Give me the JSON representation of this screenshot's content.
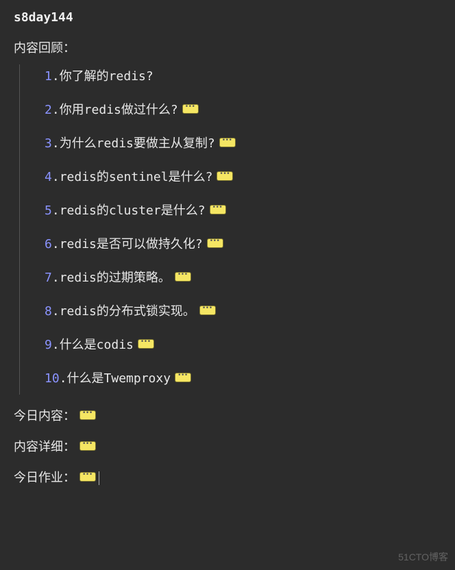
{
  "title": "s8day144",
  "review_label": "内容回顾：",
  "items": [
    {
      "n": "1",
      "text": "你了解的redis?",
      "badge": false
    },
    {
      "n": "2",
      "text": "你用redis做过什么?",
      "badge": true
    },
    {
      "n": "3",
      "text": "为什么redis要做主从复制?",
      "badge": true
    },
    {
      "n": "4",
      "text": "redis的sentinel是什么?",
      "badge": true
    },
    {
      "n": "5",
      "text": "redis的cluster是什么?",
      "badge": true
    },
    {
      "n": "6",
      "text": "redis是否可以做持久化?",
      "badge": true
    },
    {
      "n": "7",
      "text": "redis的过期策略。",
      "badge": true
    },
    {
      "n": "8",
      "text": "redis的分布式锁实现。",
      "badge": true
    },
    {
      "n": "9",
      "text": "什么是codis",
      "badge": true
    },
    {
      "n": "10",
      "text": "什么是Twemproxy",
      "badge": true
    }
  ],
  "sections": [
    {
      "label": "今日内容：",
      "badge": true,
      "cursor": false
    },
    {
      "label": "内容详细：",
      "badge": true,
      "cursor": false
    },
    {
      "label": "今日作业：",
      "badge": true,
      "cursor": true
    }
  ],
  "watermark": "51CTO博客"
}
